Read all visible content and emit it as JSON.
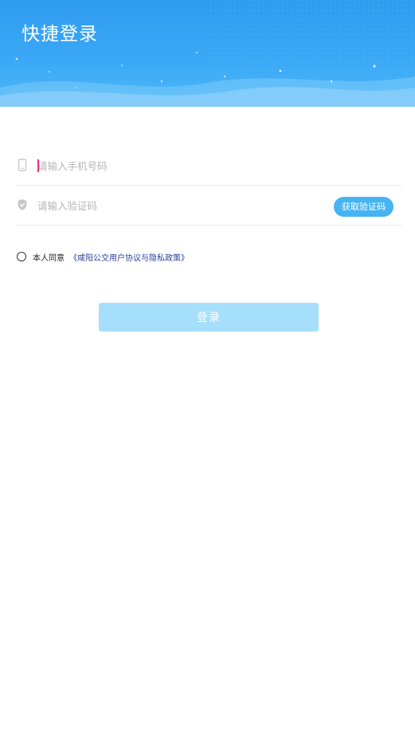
{
  "header": {
    "title": "快捷登录"
  },
  "form": {
    "phone_placeholder": "请输入手机号码",
    "code_placeholder": "请输入验证码",
    "get_code_label": "获取验证码"
  },
  "agreement": {
    "prefix": "本人同意",
    "link": "《咸阳公交用户协议与隐私政策》",
    "checked": false
  },
  "login_label": "登录",
  "colors": {
    "header_blue": "#3aa8f6",
    "button_blue": "#45b4f3",
    "login_disabled": "#a6dffb",
    "link_blue": "#2a3d9c",
    "caret": "#e0357a"
  }
}
